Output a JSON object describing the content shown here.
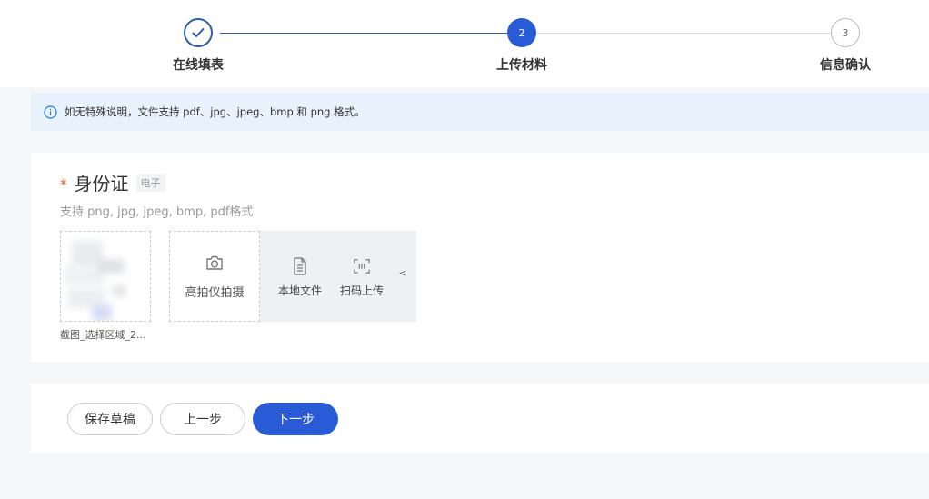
{
  "steps": [
    {
      "index": "1",
      "label": "在线填表",
      "status": "done",
      "icon": "check-icon"
    },
    {
      "index": "2",
      "label": "上传材料",
      "status": "active"
    },
    {
      "index": "3",
      "label": "信息确认",
      "status": "todo"
    }
  ],
  "notice": {
    "icon": "info-icon",
    "text": "如无特殊说明，文件支持 pdf、jpg、jpeg、bmp 和 png 格式。"
  },
  "upload": {
    "required_mark": "*",
    "doc_name": "身份证",
    "doc_tag": "电子",
    "hint": "支持 png, jpg, jpeg, bmp, pdf格式",
    "file": {
      "name": "截图_选择区域_2..."
    },
    "camera": {
      "label": "高拍仪拍摄",
      "icon": "camera-icon"
    },
    "options": [
      {
        "label": "本地文件",
        "icon": "file-icon"
      },
      {
        "label": "扫码上传",
        "icon": "scan-icon"
      }
    ],
    "collapse_glyph": "<"
  },
  "footer": {
    "save_label": "保存草稿",
    "prev_label": "上一步",
    "next_label": "下一步"
  },
  "colors": {
    "primary": "#2a5bd7",
    "step_done": "#2d5fa8",
    "notice_bg": "#e8f2fd",
    "required": "#e4572e"
  }
}
